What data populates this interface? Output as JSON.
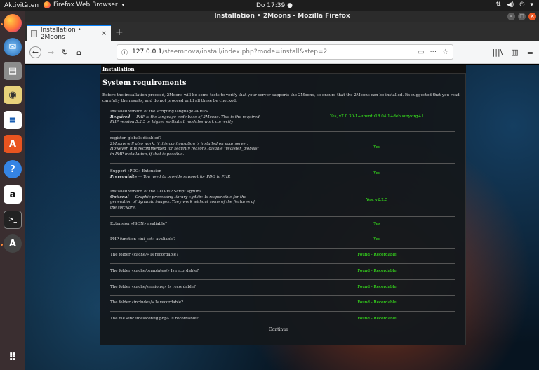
{
  "topbar": {
    "activities": "Aktivitäten",
    "app_name": "Firefox Web Browser",
    "clock": "Do 17:39 ●"
  },
  "window": {
    "title": "Installation • 2Moons - Mozilla Firefox"
  },
  "tab": {
    "label": "Installation • 2Moons"
  },
  "url": {
    "host": "127.0.0.1",
    "path": "/steemnova/install/index.php?mode=install&step=2"
  },
  "page": {
    "section_label": "Installation",
    "heading": "System requirements",
    "intro": "Before the installation proceed, 2Moons will be some tests to verify that your server supports the 2Moons, so ensure that the 2Moons can be installed. Its suggested that you read carefully the results, and do not proceed until all these be checked.",
    "requirements": [
      {
        "title": "Installed version of the scripting language «PHP»",
        "desc_prefix": "Required",
        "desc": " — PHP is the language code base of 2Moons. This is the required PHP version 5.2.5 or higher so that all modules work correctly",
        "value": "Yes, v7.0.30-1+ubuntu18.04.1+deb.sury.org+1"
      },
      {
        "title": "register_globals disabled?",
        "desc_prefix": "",
        "desc": "2Moons will also work, if this configuration is installed on your server. However, it is recommended for security reasons, disable \"register_globals\" in PHP installation, if that is possible.",
        "value": "Yes"
      },
      {
        "title": "Support «PDO» Extension",
        "desc_prefix": "Prerequisite",
        "desc": " — You need to provide support for PDO in PHP.",
        "value": "Yes"
      },
      {
        "title": "Installed version of the GD PHP Script «gdlib»",
        "desc_prefix": "Optional",
        "desc": " — Graphic processing library «gdlib» Is responsible for the generation of dynamic images. They work without some of the features of the software.",
        "value": "Yes, v2.2.5"
      },
      {
        "title": "Extension «JSON» avaliable?",
        "desc_prefix": "",
        "desc": "",
        "value": "Yes"
      },
      {
        "title": "PHP function «ini_set» avaliable?",
        "desc_prefix": "",
        "desc": "",
        "value": "Yes"
      },
      {
        "title": "The folder «cache/» Is recordable?",
        "desc_prefix": "",
        "desc": "",
        "value": "Found - Recordable"
      },
      {
        "title": "The folder «cache/templates/» Is recordable?",
        "desc_prefix": "",
        "desc": "",
        "value": "Found - Recordable"
      },
      {
        "title": "The folder «cache/sessions/» Is recordable?",
        "desc_prefix": "",
        "desc": "",
        "value": "Found - Recordable"
      },
      {
        "title": "The folder «includes/» Is recordable?",
        "desc_prefix": "",
        "desc": "",
        "value": "Found - Recordable"
      },
      {
        "title": "The file «includes/config.php» Is recordable?",
        "desc_prefix": "",
        "desc": "",
        "value": "Found - Recordable"
      }
    ],
    "continue_label": "Continue"
  },
  "colors": {
    "ok_green": "#3cff1c",
    "ubuntu_orange": "#e95420",
    "firefox_blue": "#0a84ff"
  },
  "icons": {
    "dock": [
      "firefox-icon",
      "thunderbird-icon",
      "files-icon",
      "rhythmbox-icon",
      "libreoffice-writer-icon",
      "software-center-icon",
      "help-icon",
      "amazon-icon",
      "terminal-icon",
      "software-updater-icon",
      "app-grid-icon"
    ]
  }
}
